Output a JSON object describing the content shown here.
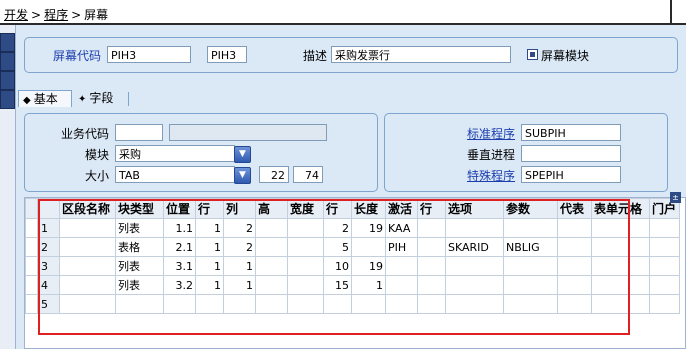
{
  "breadcrumb": {
    "items": [
      "开发",
      "程序",
      "屏幕"
    ],
    "separator": ">"
  },
  "header": {
    "screen_code_label": "屏幕代码",
    "screen_code_value": "PIH3",
    "screen_code_value2": "PIH3",
    "description_label": "描述",
    "description_value": "采购发票行",
    "screen_module_label": "屏幕模块"
  },
  "tabs": [
    {
      "label": "基本",
      "icon": "◆"
    },
    {
      "label": "字段",
      "icon": "✦"
    }
  ],
  "form": {
    "business_code_label": "业务代码",
    "business_code_value": "",
    "business_code_desc": "",
    "module_label": "模块",
    "module_value": "采购",
    "size_label": "大小",
    "size_value": "TAB",
    "size_width": "22",
    "size_height": "74"
  },
  "programs": {
    "standard_label": "标准程序",
    "standard_value": "SUBPIH",
    "vertical_label": "垂直进程",
    "vertical_value": "",
    "special_label": "特殊程序",
    "special_value": "SPEPIH"
  },
  "grid": {
    "columns": [
      "",
      "区段名称",
      "块类型",
      "位置",
      "行",
      "列",
      "高",
      "宽度",
      "行",
      "长度",
      "激活",
      "行",
      "选项",
      "参数",
      "代表",
      "表单元格",
      "门户"
    ],
    "rows": [
      [
        "1",
        "",
        "列表",
        "1.1",
        "1",
        "2",
        "",
        "",
        "2",
        "19",
        "KAA",
        "",
        "",
        "",
        "",
        "",
        ""
      ],
      [
        "2",
        "",
        "表格",
        "2.1",
        "1",
        "2",
        "",
        "",
        "5",
        "",
        "PIH",
        "",
        "SKARID",
        "NBLIG",
        "",
        "",
        ""
      ],
      [
        "3",
        "",
        "列表",
        "3.1",
        "1",
        "1",
        "",
        "",
        "10",
        "19",
        "",
        "",
        "",
        "",
        "",
        "",
        ""
      ],
      [
        "4",
        "",
        "列表",
        "3.2",
        "1",
        "1",
        "",
        "",
        "15",
        "1",
        "",
        "",
        "",
        "",
        "",
        "",
        ""
      ],
      [
        "5",
        "",
        "",
        "",
        "",
        "",
        "",
        "",
        "",
        "",
        "",
        "",
        "",
        "",
        "",
        "",
        ""
      ]
    ]
  },
  "colors": {
    "panel_bg": "#dbe8f5",
    "border": "#7ea4d0",
    "label_blue": "#1d3fae",
    "highlight_red": "#e02020"
  }
}
